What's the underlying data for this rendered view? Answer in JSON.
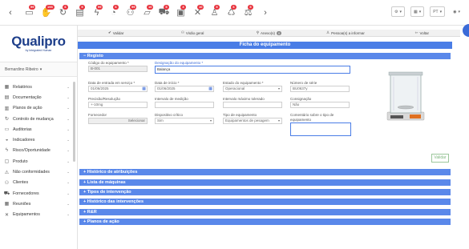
{
  "toolbar": {
    "icons": [
      {
        "name": "document-icon",
        "glyph": "▭",
        "badge": "99"
      },
      {
        "name": "hand-icon",
        "glyph": "✋",
        "badge": "193"
      },
      {
        "name": "refresh-icon",
        "glyph": "↻",
        "badge": "6"
      },
      {
        "name": "clipboard-icon",
        "glyph": "▤",
        "badge": "5"
      },
      {
        "name": "bolt-icon",
        "glyph": "ϟ",
        "badge": "99"
      },
      {
        "name": "gauge-icon",
        "glyph": "◔",
        "badge": "6"
      },
      {
        "name": "people-icon",
        "glyph": "⚇",
        "badge": "99"
      },
      {
        "name": "chat-icon",
        "glyph": "▱",
        "badge": "10"
      },
      {
        "name": "truck-icon",
        "glyph": "⛟",
        "badge": "5"
      },
      {
        "name": "box-icon",
        "glyph": "▣",
        "badge": "3"
      },
      {
        "name": "tools-icon",
        "glyph": "✕",
        "badge": "10"
      },
      {
        "name": "person-icon",
        "glyph": "♙",
        "badge": "5"
      },
      {
        "name": "recycle-icon",
        "glyph": "♺",
        "badge": "6"
      },
      {
        "name": "scale-icon",
        "glyph": "⚖",
        "badge": "5"
      }
    ],
    "language": "PT"
  },
  "logo": {
    "name": "Qualipro",
    "subtitle": "by Integrated Human"
  },
  "user": {
    "name": "Bernardino Ribeiro"
  },
  "menu": [
    {
      "icon": "chart-icon",
      "glyph": "▦",
      "label": "Relatórios"
    },
    {
      "icon": "doc-icon",
      "glyph": "▤",
      "label": "Documentação"
    },
    {
      "icon": "calendar-icon",
      "glyph": "▥",
      "label": "Planos de ação"
    },
    {
      "icon": "change-icon",
      "glyph": "↻",
      "label": "Controlo de mudança"
    },
    {
      "icon": "audit-icon",
      "glyph": "▭",
      "label": "Auditorias"
    },
    {
      "icon": "indicator-icon",
      "glyph": "◒",
      "label": "Indicadores"
    },
    {
      "icon": "risk-icon",
      "glyph": "ϟ",
      "label": "Risco/Oportunidade"
    },
    {
      "icon": "product-icon",
      "glyph": "▢",
      "label": "Produto"
    },
    {
      "icon": "nonconformity-icon",
      "glyph": "⚠",
      "label": "Não conformidades"
    },
    {
      "icon": "clients-icon",
      "glyph": "⚇",
      "label": "Clientes"
    },
    {
      "icon": "suppliers-icon",
      "glyph": "⛟",
      "label": "Fornecedores"
    },
    {
      "icon": "meetings-icon",
      "glyph": "▦",
      "label": "Reuniões"
    },
    {
      "icon": "equipment-icon",
      "glyph": "✕",
      "label": "Equipamentos"
    }
  ],
  "actions": {
    "validate": "Validar",
    "overview": "Visão geral",
    "attachments": "Anexo(s)",
    "attachments_count": "0",
    "notify": "Pessoa(s) a informar",
    "back": "Voltar"
  },
  "page_title": "Ficha do equipamento",
  "registo": {
    "title": "Registo",
    "codigo": {
      "label": "Código do equipamento *",
      "value": "B-001"
    },
    "designacao": {
      "label": "Designação do equipamento *",
      "value": "Balança"
    },
    "data_entrada": {
      "label": "Data de entrada em serviço *",
      "value": "01/06/2025"
    },
    "data_inicio": {
      "label": "Data de início *",
      "value": "01/06/2025"
    },
    "estado": {
      "label": "Estado do equipamento *",
      "value": "Operacional"
    },
    "numero_serie": {
      "label": "Número de série",
      "value": "BU0637y"
    },
    "precisao": {
      "label": "Precisão/Resolução",
      "value": "+-10mg"
    },
    "intervalo_medicao": {
      "label": "Intervalo de medição",
      "value": ""
    },
    "intervalo_tolerado": {
      "label": "Intervalo máximo tolerado",
      "value": ""
    },
    "consignacao": {
      "label": "Consignação",
      "value": "Não"
    },
    "fornecedor": {
      "label": "Fornecedor",
      "value": "Selecionar"
    },
    "dispositivo_critico": {
      "label": "Dispositivo crítico",
      "value": "Sim"
    },
    "tipo": {
      "label": "Tipo de equipamento",
      "value": "Equipamentos de pesagem"
    },
    "comentario": {
      "label": "Comentário sobre o tipo de equipamento",
      "value": ""
    },
    "save": "Validar"
  },
  "sections": [
    "Histórico de atribuições",
    "Lista de máquinas",
    "Tipos de intervenção",
    "Histórico das intervenções",
    "R&R",
    "Planos de ação"
  ]
}
